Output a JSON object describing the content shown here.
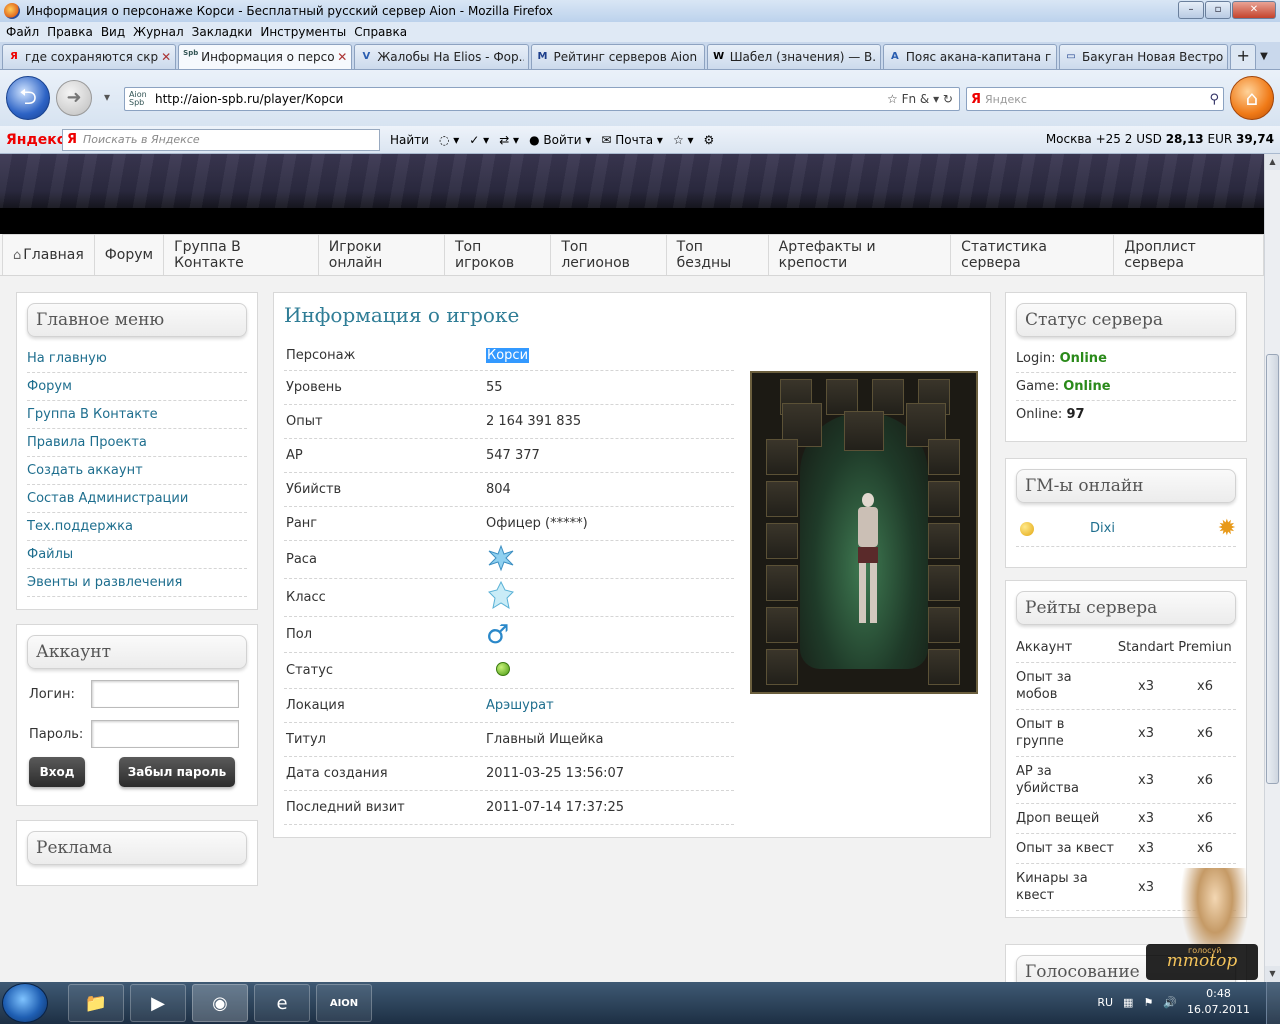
{
  "window": {
    "title": "Информация о персонаже Корси - Бесплатный русский сервер Aion - Mozilla Firefox",
    "buttons": [
      "–",
      "▫",
      "✕"
    ]
  },
  "menubar": [
    "Файл",
    "Правка",
    "Вид",
    "Журнал",
    "Закладки",
    "Инструменты",
    "Справка"
  ],
  "tabs": [
    {
      "label": "где сохраняются скри...",
      "fav": "Я",
      "favcolor": "#e00"
    },
    {
      "label": "Информация о персо...",
      "fav": "Spb",
      "favcolor": "#355",
      "active": true
    },
    {
      "label": "Жалобы На Elios - Фор...",
      "fav": "V",
      "favcolor": "#2a5db0"
    },
    {
      "label": "Рейтинг серверов Aion",
      "fav": "M",
      "favcolor": "#1d3f8c"
    },
    {
      "label": "Шабел (значения) — В...",
      "fav": "W",
      "favcolor": "#000"
    },
    {
      "label": "Пояс акана-капитана г...",
      "fav": "A",
      "favcolor": "#2a5db0"
    },
    {
      "label": "Бакуган Новая Вестро...",
      "fav": "▭",
      "favcolor": "#1d3f8c"
    }
  ],
  "nav": {
    "url": "http://aion-spb.ru/player/Корси",
    "search_placeholder": "Яндекс",
    "url_tools": "☆ Fn & ▾ ↻"
  },
  "yandex_bar": {
    "logo": "Яндекс",
    "search_placeholder": "Поискать в Яндексе",
    "find": "Найти",
    "login": "Войти",
    "mail": "Почта",
    "city": "Москва",
    "temp": "+25",
    "traffic": "2",
    "usd_label": "USD",
    "usd": "28,13",
    "eur_label": "EUR",
    "eur": "39,74"
  },
  "topnav": [
    "Главная",
    "Форум",
    "Группа В Контакте",
    "Игроки онлайн",
    "Топ игроков",
    "Топ легионов",
    "Топ бездны",
    "Артефакты и крепости",
    "Статистика сервера",
    "Дроплист сервера"
  ],
  "left": {
    "menu_title": "Главное меню",
    "menu": [
      "На главную",
      "Форум",
      "Группа В Контакте",
      "Правила Проекта",
      "Создать аккаунт",
      "Состав Администрации",
      "Тех.поддержка",
      "Файлы",
      "Эвенты и развлечения"
    ],
    "account_title": "Аккаунт",
    "login_label": "Логин:",
    "password_label": "Пароль:",
    "enter": "Вход",
    "forgot": "Забыл пароль",
    "ads_title": "Реклама"
  },
  "main": {
    "title": "Информация о игроке",
    "rows": [
      {
        "k": "Персонаж",
        "v": "Корси"
      },
      {
        "k": "Уровень",
        "v": "55"
      },
      {
        "k": "Опыт",
        "v": "2 164 391 835"
      },
      {
        "k": "AP",
        "v": "547 377"
      },
      {
        "k": "Убийств",
        "v": "804"
      },
      {
        "k": "Ранг",
        "v": "Офицер (*****)"
      },
      {
        "k": "Раса",
        "v": ""
      },
      {
        "k": "Класс",
        "v": ""
      },
      {
        "k": "Пол",
        "v": "♂"
      },
      {
        "k": "Статус",
        "v": ""
      },
      {
        "k": "Локация",
        "v": "Арэшурат"
      },
      {
        "k": "Титул",
        "v": "Главный Ищейка"
      },
      {
        "k": "Дата создания",
        "v": "2011-03-25 13:56:07"
      },
      {
        "k": "Последний визит",
        "v": "2011-07-14 17:37:25"
      }
    ]
  },
  "right": {
    "status_title": "Статус сервера",
    "login_label": "Login:",
    "login_val": "Online",
    "game_label": "Game:",
    "game_val": "Online",
    "online_label": "Online:",
    "online_val": "97",
    "gm_title": "ГМ-ы онлайн",
    "gm_name": "Dixi",
    "rates_title": "Рейты сервера",
    "rates_head": [
      "Аккаунт",
      "Standart",
      "Premiun"
    ],
    "rates": [
      {
        "n": "Опыт за мобов",
        "s": "x3",
        "p": "x6"
      },
      {
        "n": "Опыт в группе",
        "s": "x3",
        "p": "x6"
      },
      {
        "n": "AP за убийства",
        "s": "x3",
        "p": "x6"
      },
      {
        "n": "Дроп вещей",
        "s": "x3",
        "p": "x6"
      },
      {
        "n": "Опыт за квест",
        "s": "x3",
        "p": "x6"
      },
      {
        "n": "Кинары за квест",
        "s": "x3",
        "p": ""
      }
    ],
    "vote_title": "Голосование"
  },
  "mmotop": {
    "label": "mmotop",
    "sub": "голосуй"
  },
  "taskbar": {
    "lang": "RU",
    "time": "0:48",
    "date": "16.07.2011"
  },
  "colors": {
    "accent": "#2f7d96",
    "link": "#1e6e8e",
    "online": "#2a8a1a"
  }
}
